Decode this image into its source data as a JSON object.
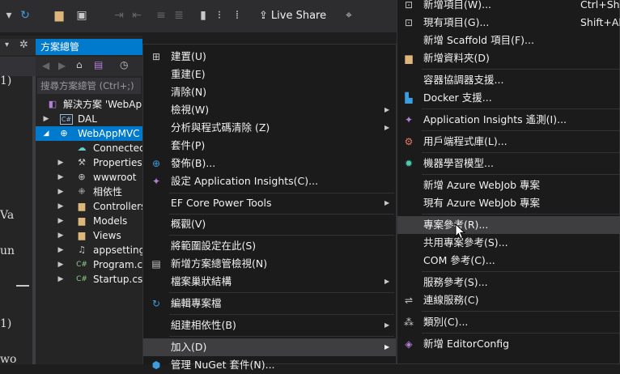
{
  "toolbar": {
    "live_share": "Live Share"
  },
  "editor_fragments": [
    "1)",
    "Va",
    "un",
    "1)",
    "wo"
  ],
  "solution_explorer": {
    "title": "方案總管",
    "search_placeholder": "搜尋方案總管 (Ctrl+;)",
    "items": [
      {
        "label": "解決方案 'WebApp",
        "indent": 0
      },
      {
        "label": "DAL",
        "indent": 1
      },
      {
        "label": "WebAppMVC",
        "indent": 1
      },
      {
        "label": "Connected",
        "indent": 2
      },
      {
        "label": "Properties",
        "indent": 2
      },
      {
        "label": "wwwroot",
        "indent": 2
      },
      {
        "label": "相依性",
        "indent": 2
      },
      {
        "label": "Controllers",
        "indent": 2
      },
      {
        "label": "Models",
        "indent": 2
      },
      {
        "label": "Views",
        "indent": 2
      },
      {
        "label": "appsetting",
        "indent": 2
      },
      {
        "label": "Program.cs",
        "indent": 2
      },
      {
        "label": "Startup.cs",
        "indent": 2
      }
    ]
  },
  "context_menu": {
    "items": [
      {
        "label": "建置(U)"
      },
      {
        "label": "重建(E)"
      },
      {
        "label": "清除(N)"
      },
      {
        "label": "檢視(W)"
      },
      {
        "label": "分析與程式碼清除 (Z)"
      },
      {
        "label": "套件(P)"
      },
      {
        "label": "發佈(B)..."
      },
      {
        "label": "設定 Application Insights(C)..."
      },
      {
        "label": "EF Core Power Tools"
      },
      {
        "label": "概觀(V)"
      },
      {
        "label": "將範圍設定在此(S)"
      },
      {
        "label": "新增方案總管檢視(N)"
      },
      {
        "label": "檔案巢狀結構"
      },
      {
        "label": "編輯專案檔"
      },
      {
        "label": "組建相依性(B)"
      },
      {
        "label": "加入(D)"
      },
      {
        "label": "管理 NuGet 套件(N)..."
      }
    ]
  },
  "submenu": {
    "items": [
      {
        "label": "新增項目(W)...",
        "shortcut": "Ctrl+Shift"
      },
      {
        "label": "現有項目(G)...",
        "shortcut": "Shift+Alt"
      },
      {
        "label": "新增 Scaffold 項目(F)..."
      },
      {
        "label": "新增資料夾(D)"
      },
      {
        "label": "容器協調器支援..."
      },
      {
        "label": "Docker 支援..."
      },
      {
        "label": "Application Insights 遙測(I)..."
      },
      {
        "label": "用戶端程式庫(L)..."
      },
      {
        "label": "機器學習模型..."
      },
      {
        "label": "新增 Azure WebJob 專案"
      },
      {
        "label": "現有 Azure WebJob 專案"
      },
      {
        "label": "專案參考(R)..."
      },
      {
        "label": "共用專案參考(S)..."
      },
      {
        "label": "COM 參考(C)..."
      },
      {
        "label": "服務參考(S)..."
      },
      {
        "label": "連線服務(C)"
      },
      {
        "label": "類別(C)..."
      },
      {
        "label": "新增 EditorConfig"
      }
    ]
  },
  "colors": {
    "accent": "#007acc",
    "menu_bg": "#1b1b1c",
    "hover": "#3e3e40"
  }
}
